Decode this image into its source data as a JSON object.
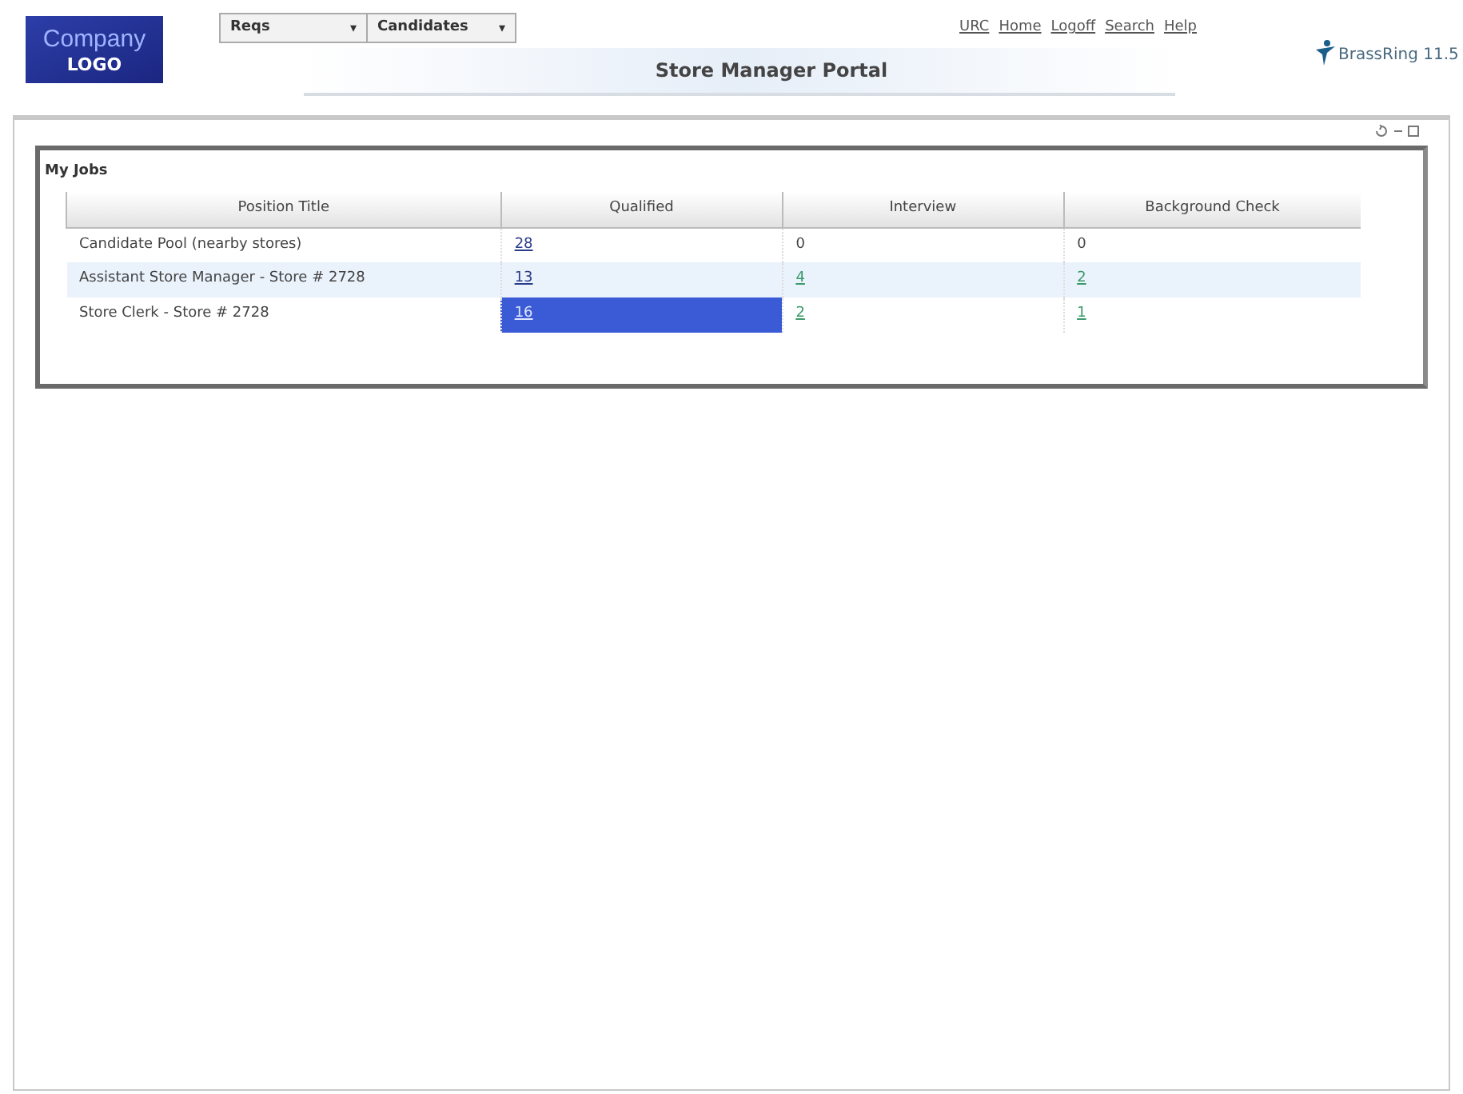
{
  "logo": {
    "line1": "Company",
    "line2": "LOGO"
  },
  "menus": [
    {
      "label": "Reqs",
      "caret": "▾"
    },
    {
      "label": "Candidates",
      "caret": "▾"
    }
  ],
  "header_title": "Store Manager Portal",
  "nav_links": [
    "URC",
    "Home",
    "Logoff",
    "Search",
    "Help"
  ],
  "brand": {
    "text": "BrassRing 11.5"
  },
  "panel": {
    "title": "My Jobs",
    "columns": [
      "Position Title",
      "Qualified",
      "Interview",
      "Background Check"
    ],
    "rows": [
      {
        "hovered": false,
        "cells": [
          {
            "text": "Candidate Pool (nearby stores)",
            "link": false,
            "selected": false
          },
          {
            "text": "28",
            "link": true,
            "selected": false
          },
          {
            "text": "0",
            "link": false,
            "selected": false
          },
          {
            "text": "0",
            "link": false,
            "selected": false
          }
        ]
      },
      {
        "hovered": true,
        "cells": [
          {
            "text": "Assistant Store Manager - Store # 2728",
            "link": false,
            "selected": false
          },
          {
            "text": "13",
            "link": true,
            "selected": false
          },
          {
            "text": "4",
            "link": true,
            "selected": false
          },
          {
            "text": "2",
            "link": true,
            "selected": false
          }
        ]
      },
      {
        "hovered": false,
        "cells": [
          {
            "text": "Store Clerk - Store # 2728",
            "link": false,
            "selected": false
          },
          {
            "text": "16",
            "link": true,
            "selected": true
          },
          {
            "text": "2",
            "link": true,
            "selected": false
          },
          {
            "text": "1",
            "link": true,
            "selected": false
          }
        ]
      }
    ]
  }
}
